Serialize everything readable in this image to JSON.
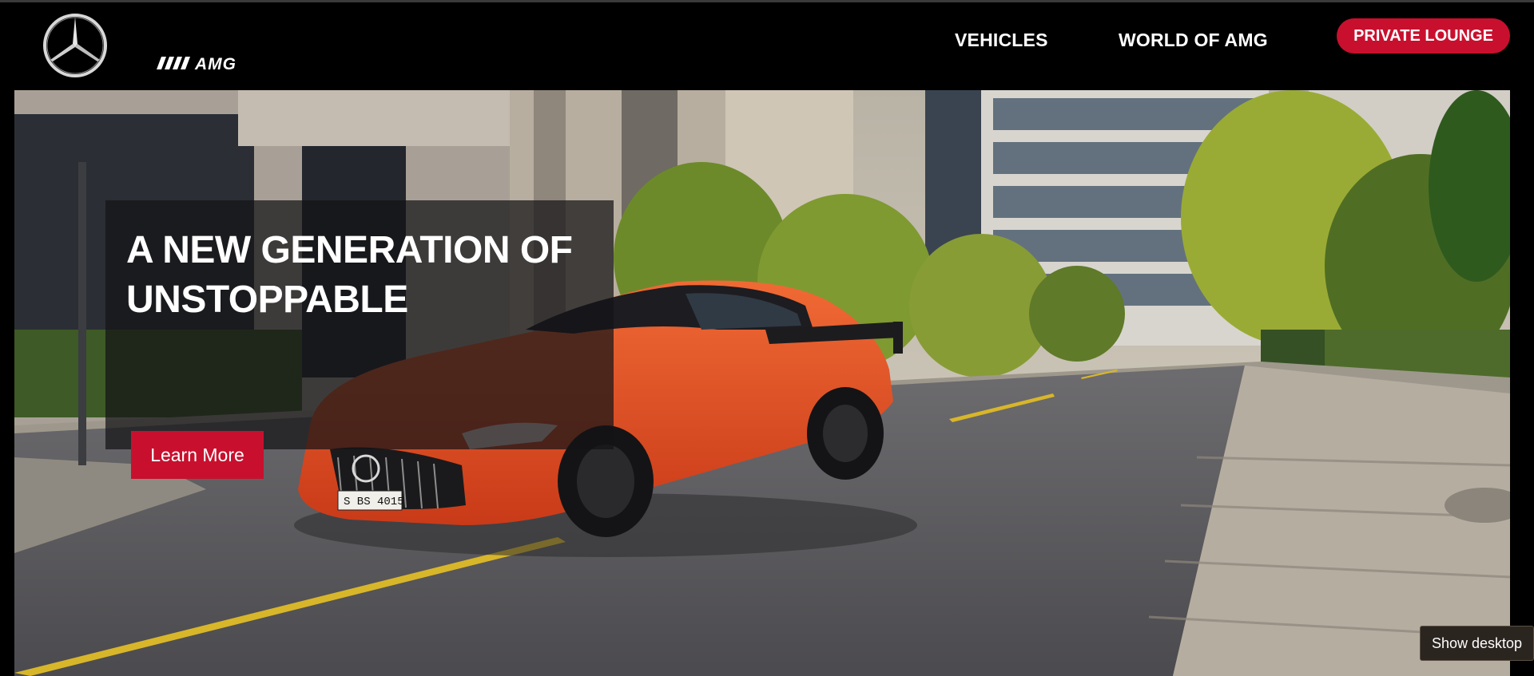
{
  "header": {
    "brand_name": "Mercedes-Benz",
    "amg_wordmark": "AMG",
    "nav": {
      "vehicles": "VEHICLES",
      "world_of_amg": "WORLD OF AMG"
    },
    "private_lounge": "PRIVATE LOUNGE"
  },
  "hero": {
    "headline_line1": "A NEW GENERATION OF",
    "headline_line2": "UNSTOPPABLE",
    "cta_label": "Learn More",
    "license_plate": "S BS 4015"
  },
  "system": {
    "tooltip": "Show desktop"
  },
  "colors": {
    "brand_red": "#c8102e",
    "car_orange": "#e8532a",
    "header_bg": "#000000"
  }
}
